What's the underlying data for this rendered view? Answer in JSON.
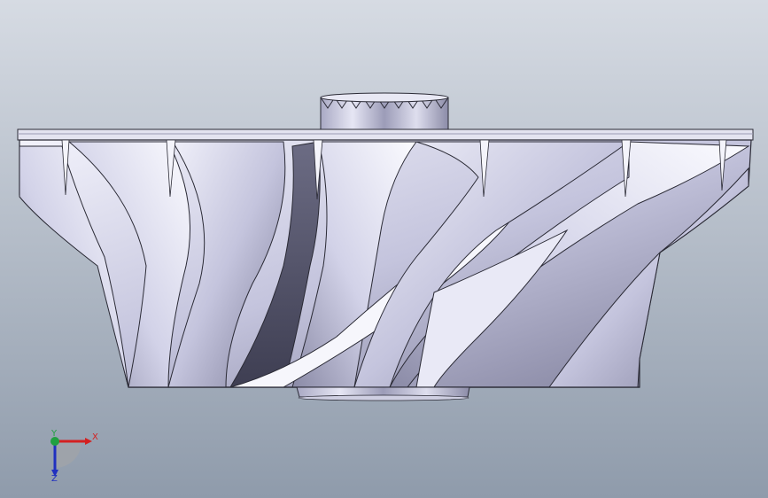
{
  "viewport": {
    "background_top": "#d6dbe3",
    "background_bottom": "#8f9bab"
  },
  "model": {
    "icon": "impeller-model",
    "body_color": "#c8c8dc",
    "edge_color": "#2a2a35"
  },
  "triad": {
    "x_label": "X",
    "y_label": "Y",
    "z_label": "Z",
    "x_color": "#d42020",
    "y_color": "#20a040",
    "z_color": "#2030c0"
  }
}
